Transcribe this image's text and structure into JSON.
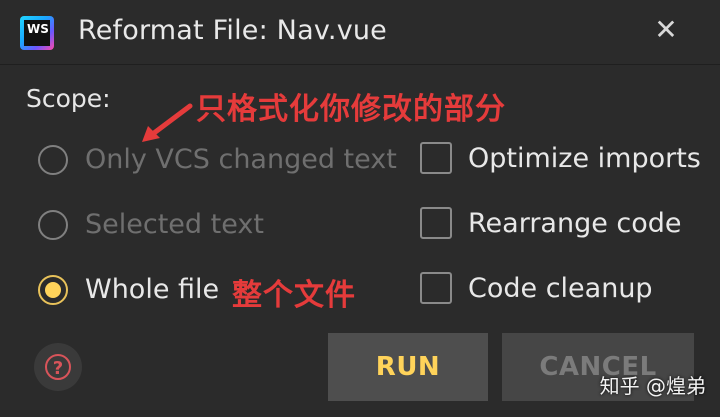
{
  "window": {
    "logo_text": "WS",
    "title": "Reformat File: Nav.vue",
    "close_glyph": "✕"
  },
  "scope": {
    "label": "Scope:",
    "options": [
      {
        "label": "Only VCS changed text",
        "checked": false,
        "disabled": true
      },
      {
        "label": "Selected text",
        "checked": false,
        "disabled": true
      },
      {
        "label": "Whole file",
        "checked": true,
        "disabled": false
      }
    ]
  },
  "options": [
    {
      "label": "Optimize imports",
      "checked": false
    },
    {
      "label": "Rearrange code",
      "checked": false
    },
    {
      "label": "Code cleanup",
      "checked": false
    }
  ],
  "annotations": {
    "top": "只格式化你修改的部分",
    "bottom": "整个文件"
  },
  "buttons": {
    "help_glyph": "?",
    "run": "RUN",
    "cancel": "CANCEL"
  },
  "watermark": "知乎 @煌弟",
  "colors": {
    "background": "#2b2b2b",
    "accent": "#ffd35a",
    "annotation": "#e53b3b"
  }
}
